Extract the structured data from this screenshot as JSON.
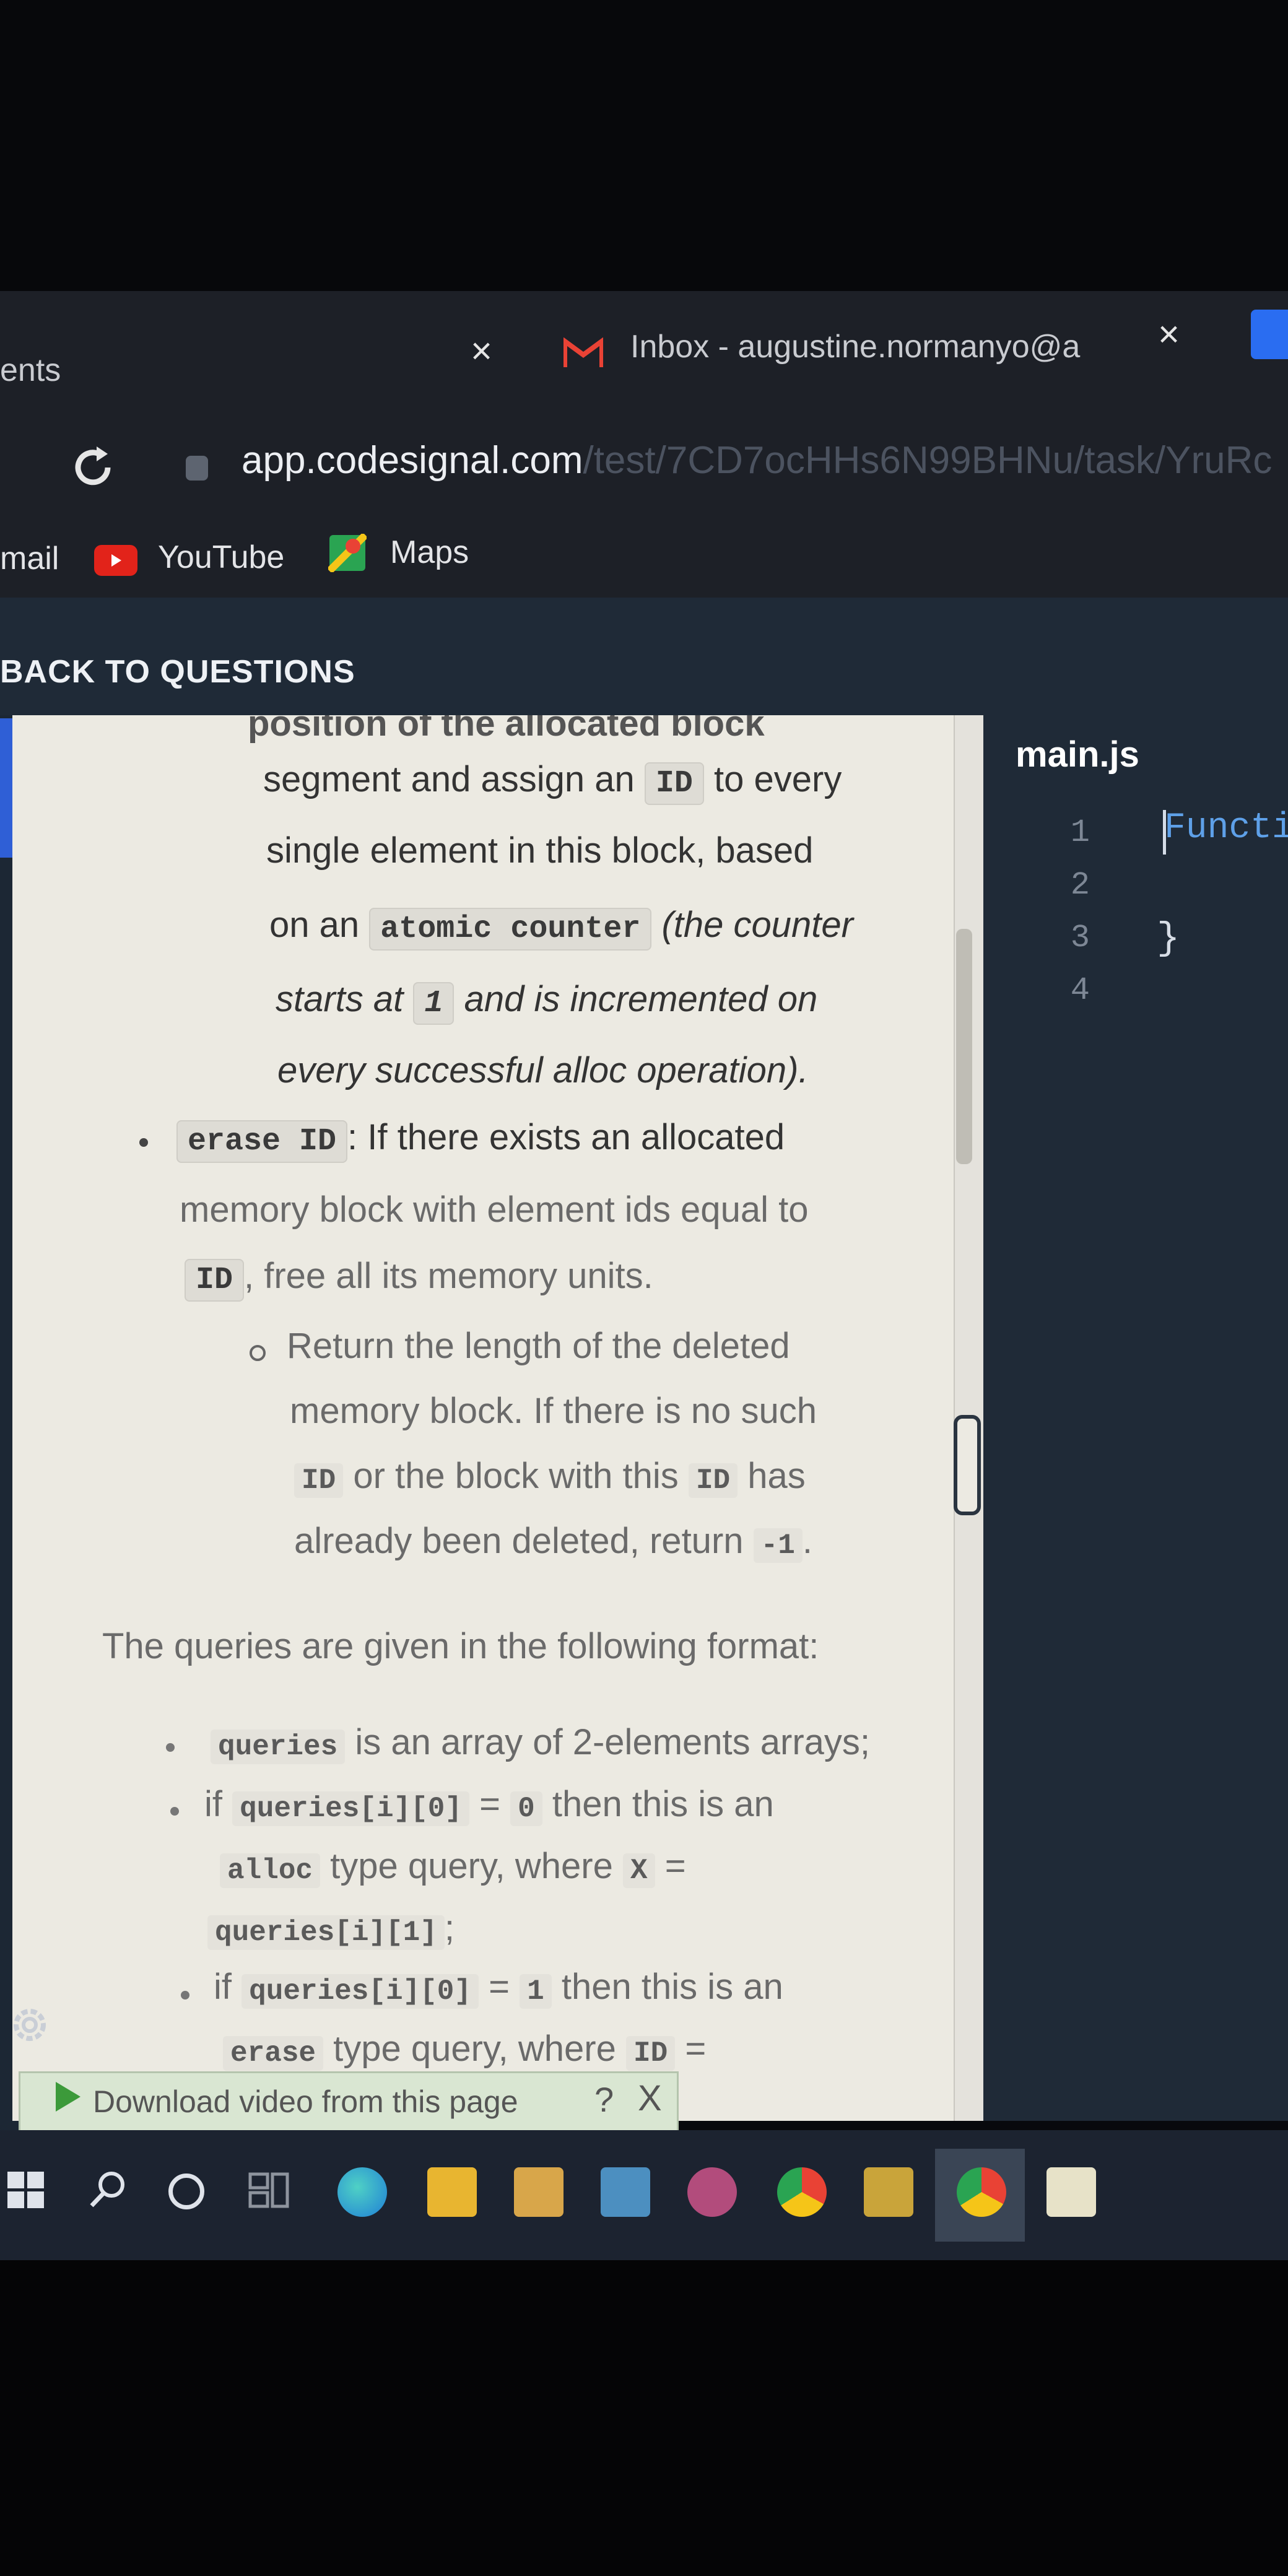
{
  "browser": {
    "tabs": [
      {
        "label": "ents"
      },
      {
        "label": "Inbox - augustine.normanyo@a"
      }
    ],
    "tab_close_glyph": "×",
    "url_main": "app.codesignal.com",
    "url_rest": "/test/7CD7ocHHs6N99BHNu/task/YruRc",
    "bookmarks": [
      "mail",
      "YouTube",
      "Maps"
    ]
  },
  "header": {
    "back_label": "BACK TO QUESTIONS"
  },
  "description": {
    "cut_top": "position of the allocated block",
    "l1a": "segment and assign an",
    "l1_code": "ID",
    "l1b": "to every",
    "l2": "single element in this block, based",
    "l3a": "on an",
    "l3_code": "atomic counter",
    "l3b": "(the counter",
    "l4a": "starts at",
    "l4_code": "1",
    "l4b": "and is incremented on",
    "l5": "every successful alloc operation).",
    "e1_code": "erase ID",
    "e1b": ": If there exists an allocated",
    "e2": "memory block with element ids equal to",
    "e3_code": "ID",
    "e3b": ", free all its memory units.",
    "s1": "Return the length of the deleted",
    "s2": "memory block. If there is no such",
    "s3_code": "ID",
    "s3b": "or the block with this",
    "s3_code2": "ID",
    "s3c": "has",
    "s4": "already been deleted, return",
    "s4_code": "-1",
    "s4b": ".",
    "format_intro": "The queries are given in the following format:",
    "q1_code": "queries",
    "q1b": "is an array of 2-elements arrays;",
    "q2a": "if",
    "q2_code": "queries[i][0]",
    "q2b": "=",
    "q2_code2": "0",
    "q2c": "then this is an",
    "q3_code": "alloc",
    "q3b": "type query, where",
    "q3_code2": "X",
    "q3c": "=",
    "q4_code": "queries[i][1]",
    "q4b": ";",
    "q5a": "if",
    "q5_code": "queries[i][0]",
    "q5b": "=",
    "q5_code2": "1",
    "q5c": "then this is an",
    "q6_code": "erase",
    "q6b": "type query, where",
    "q6_code2": "ID",
    "q6c": "="
  },
  "editor": {
    "file_name": "main.js",
    "line_numbers": [
      "1",
      "2",
      "3",
      "4"
    ],
    "line1": "Functi",
    "line3": "}"
  },
  "download_bar": {
    "label": "Download video from this page",
    "help": "?",
    "close": "X"
  },
  "colors": {
    "accent": "#2f5fd6",
    "panel_bg": "#eceae2",
    "editor_bg": "#1f2a37",
    "code_keyword": "#5ea0e8"
  },
  "taskbar_icons": [
    "start-icon",
    "search-icon",
    "cortana-icon",
    "task-view-icon",
    "edge-icon",
    "file-explorer-icon",
    "store-icon",
    "mail-icon",
    "github-icon",
    "chrome-icon",
    "app-icon",
    "chrome-active-icon",
    "notes-icon"
  ]
}
